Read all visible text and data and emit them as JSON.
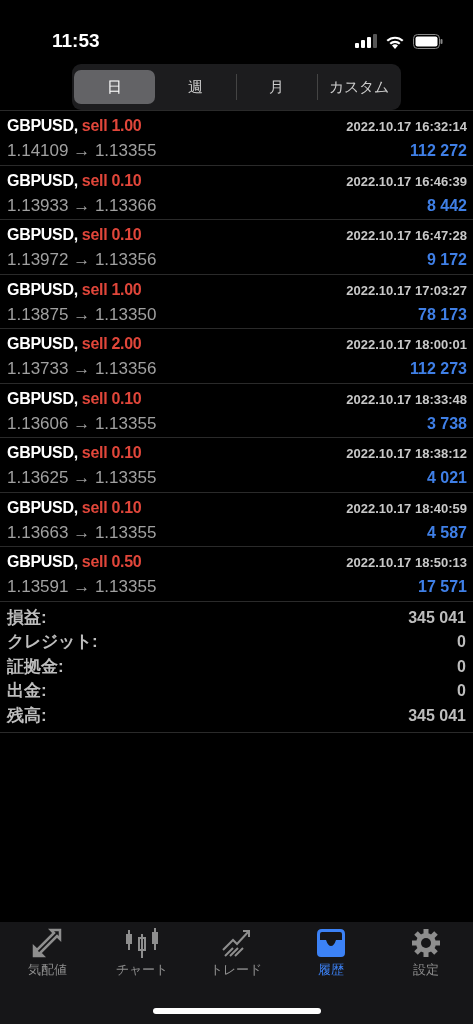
{
  "status_bar": {
    "time": "11:53"
  },
  "period_tabs": [
    {
      "label": "日",
      "selected": true
    },
    {
      "label": "週",
      "selected": false
    },
    {
      "label": "月",
      "selected": false
    },
    {
      "label": "カスタム",
      "selected": false
    }
  ],
  "deals": [
    {
      "symbol": "GBPUSD,",
      "order": "sell 1.00",
      "time": "2022.10.17 16:32:14",
      "prices": "1.14109 → 1.13355",
      "profit": "112 272"
    },
    {
      "symbol": "GBPUSD,",
      "order": "sell 0.10",
      "time": "2022.10.17 16:46:39",
      "prices": "1.13933 → 1.13366",
      "profit": "8 442"
    },
    {
      "symbol": "GBPUSD,",
      "order": "sell 0.10",
      "time": "2022.10.17 16:47:28",
      "prices": "1.13972 → 1.13356",
      "profit": "9 172"
    },
    {
      "symbol": "GBPUSD,",
      "order": "sell 1.00",
      "time": "2022.10.17 17:03:27",
      "prices": "1.13875 → 1.13350",
      "profit": "78 173"
    },
    {
      "symbol": "GBPUSD,",
      "order": "sell 2.00",
      "time": "2022.10.17 18:00:01",
      "prices": "1.13733 → 1.13356",
      "profit": "112 273"
    },
    {
      "symbol": "GBPUSD,",
      "order": "sell 0.10",
      "time": "2022.10.17 18:33:48",
      "prices": "1.13606 → 1.13355",
      "profit": "3 738"
    },
    {
      "symbol": "GBPUSD,",
      "order": "sell 0.10",
      "time": "2022.10.17 18:38:12",
      "prices": "1.13625 → 1.13355",
      "profit": "4 021"
    },
    {
      "symbol": "GBPUSD,",
      "order": "sell 0.10",
      "time": "2022.10.17 18:40:59",
      "prices": "1.13663 → 1.13355",
      "profit": "4 587"
    },
    {
      "symbol": "GBPUSD,",
      "order": "sell 0.50",
      "time": "2022.10.17 18:50:13",
      "prices": "1.13591 → 1.13355",
      "profit": "17 571"
    }
  ],
  "summary": [
    {
      "label": "損益:",
      "value": "345 041"
    },
    {
      "label": "クレジット:",
      "value": "0"
    },
    {
      "label": "証拠金:",
      "value": "0"
    },
    {
      "label": "出金:",
      "value": "0"
    },
    {
      "label": "残高:",
      "value": "345 041"
    }
  ],
  "tab_bar": [
    {
      "kind": "quotes",
      "label": "気配値",
      "selected": false
    },
    {
      "kind": "chart",
      "label": "チャート",
      "selected": false
    },
    {
      "kind": "trade",
      "label": "トレード",
      "selected": false
    },
    {
      "kind": "history",
      "label": "履歴",
      "selected": true
    },
    {
      "kind": "settings",
      "label": "設定",
      "selected": false
    }
  ]
}
